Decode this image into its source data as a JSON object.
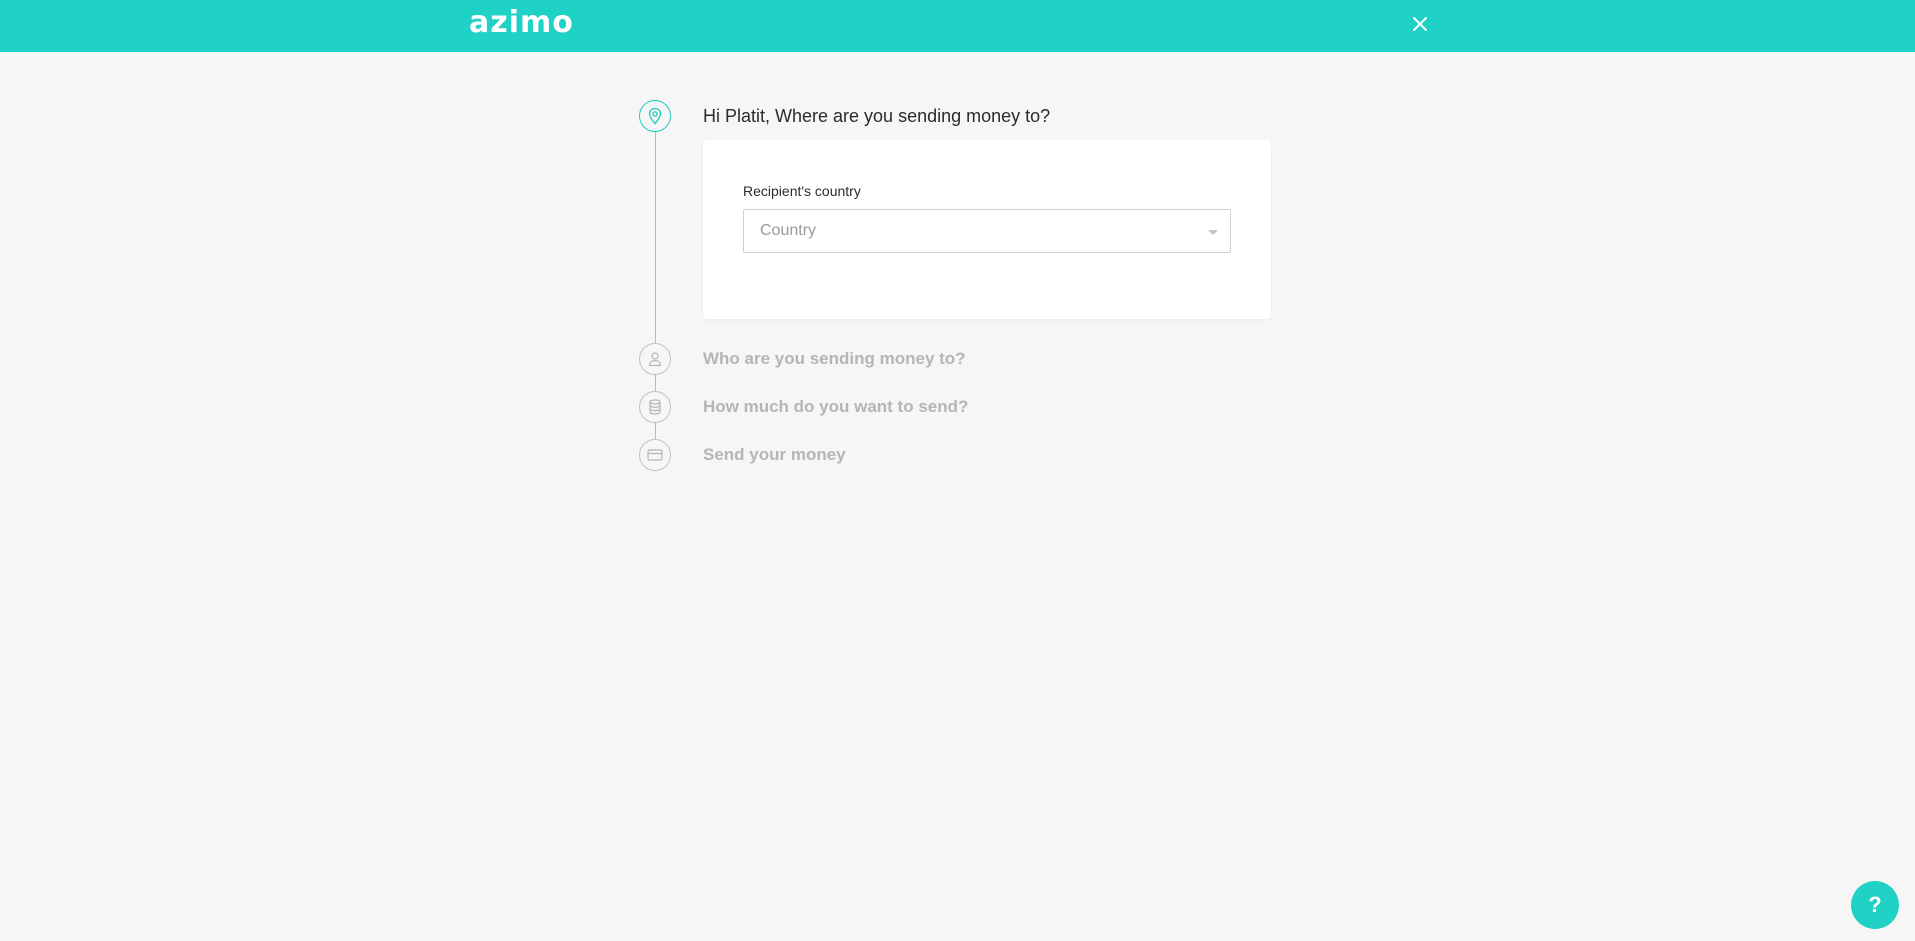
{
  "header": {
    "logo_text": "azimo",
    "close_icon": "close-icon",
    "brand_color": "#20d1c5"
  },
  "steps": [
    {
      "title": "Hi Platit, Where are you sending money to?",
      "icon": "location-pin-icon",
      "state": "active"
    },
    {
      "title": "Who are you sending money to?",
      "icon": "person-icon",
      "state": "inactive"
    },
    {
      "title": "How much do you want to send?",
      "icon": "coins-icon",
      "state": "inactive"
    },
    {
      "title": "Send your money",
      "icon": "card-icon",
      "state": "inactive"
    }
  ],
  "country_form": {
    "label": "Recipient's country",
    "placeholder": "Country",
    "value": ""
  },
  "help": {
    "label": "?"
  }
}
